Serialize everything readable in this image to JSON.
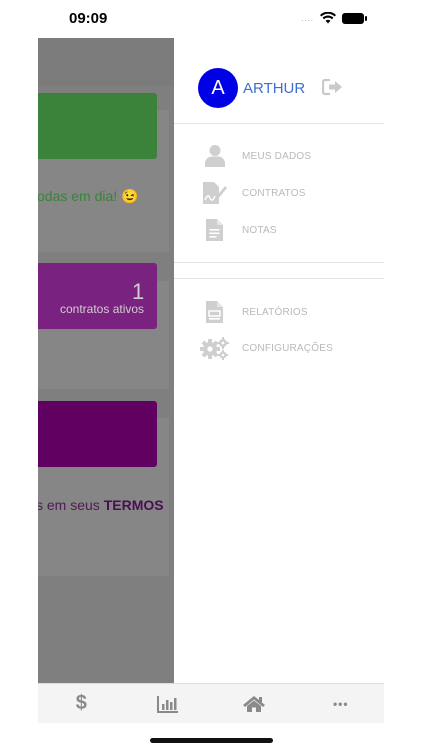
{
  "status_bar": {
    "time": "09:09",
    "signal": "....",
    "icons": [
      "wifi-icon",
      "battery-icon"
    ]
  },
  "background": {
    "card1": {
      "color": "#3b823b",
      "text": "odas em dia! 😉"
    },
    "card2": {
      "color": "#7a227f",
      "count": "1",
      "count_label": "contratos ativos"
    },
    "card3": {
      "color": "#600060",
      "text_prefix": "s em seus ",
      "text_bold": "TERMOS"
    }
  },
  "drawer": {
    "avatar_letter": "A",
    "user_name": "ARTHUR",
    "menu_group1": [
      {
        "label": "MEUS DADOS",
        "icon": "user-icon"
      },
      {
        "label": "CONTRATOS",
        "icon": "signature-icon"
      },
      {
        "label": "NOTAS",
        "icon": "document-icon"
      }
    ],
    "menu_group2": [
      {
        "label": "RELATÓRIOS",
        "icon": "report-icon"
      },
      {
        "label": "CONFIGURAÇÕES",
        "icon": "gears-icon"
      }
    ]
  },
  "tabbar": [
    {
      "icon": "dollar-icon",
      "glyph": "$"
    },
    {
      "icon": "bar-chart-icon"
    },
    {
      "icon": "home-icon"
    },
    {
      "icon": "more-icon",
      "glyph": "•••"
    }
  ],
  "colors": {
    "avatar": "#0000e6",
    "user_name": "#3e6fcf",
    "overlay": "#7f7f7f"
  }
}
